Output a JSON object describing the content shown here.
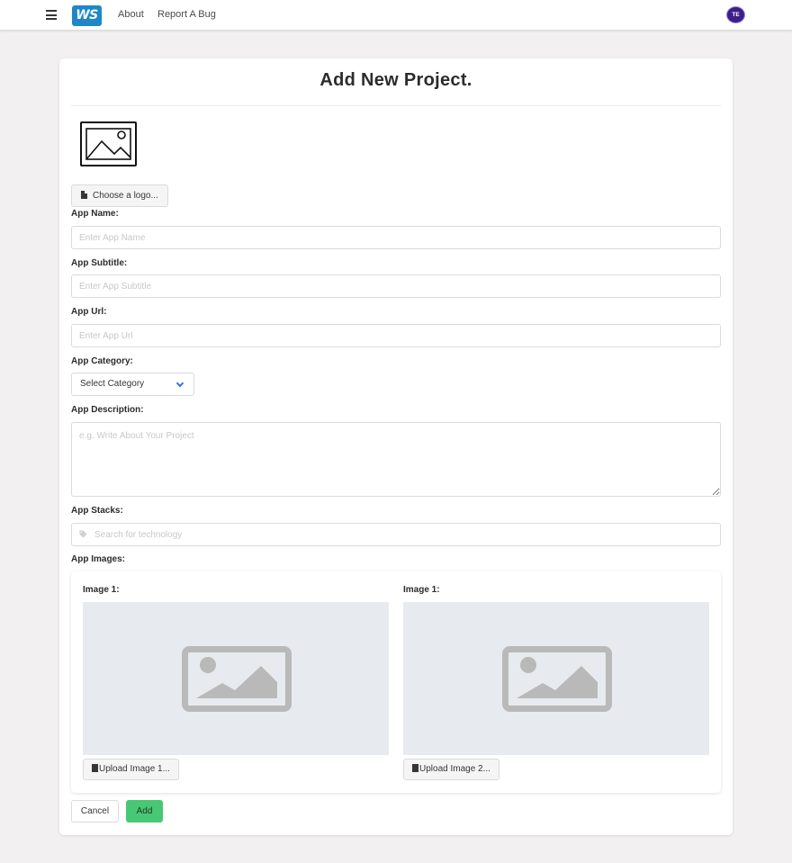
{
  "nav": {
    "logo_text": "WS",
    "about_label": "About",
    "bug_label": "Report A Bug",
    "avatar_initials": "TE"
  },
  "page": {
    "title": "Add New Project."
  },
  "form": {
    "logo_button_label": "Choose a logo...",
    "app_name": {
      "label": "App Name:",
      "placeholder": "Enter App Name",
      "value": ""
    },
    "app_subtitle": {
      "label": "App Subtitle:",
      "placeholder": "Enter App Subtitle",
      "value": ""
    },
    "app_url": {
      "label": "App Url:",
      "placeholder": "Enter App Url",
      "value": ""
    },
    "app_category": {
      "label": "App Category:",
      "selected": "Select Category"
    },
    "app_description": {
      "label": "App Description:",
      "placeholder": "e.g. Write About Your Project"
    },
    "app_stacks": {
      "label": "App Stacks:",
      "placeholder": "Search for technology"
    },
    "app_images": {
      "label": "App Images:",
      "images": [
        {
          "label": "Image 1:",
          "upload_label": "Upload Image 1..."
        },
        {
          "label": "Image 1:",
          "upload_label": "Upload Image 2..."
        }
      ]
    },
    "cancel_label": "Cancel",
    "add_label": "Add"
  },
  "colors": {
    "brand": "#1e88c7",
    "add_button": "#48c774",
    "select_chevron": "#3273dc",
    "page_background": "#f2f0f1"
  }
}
